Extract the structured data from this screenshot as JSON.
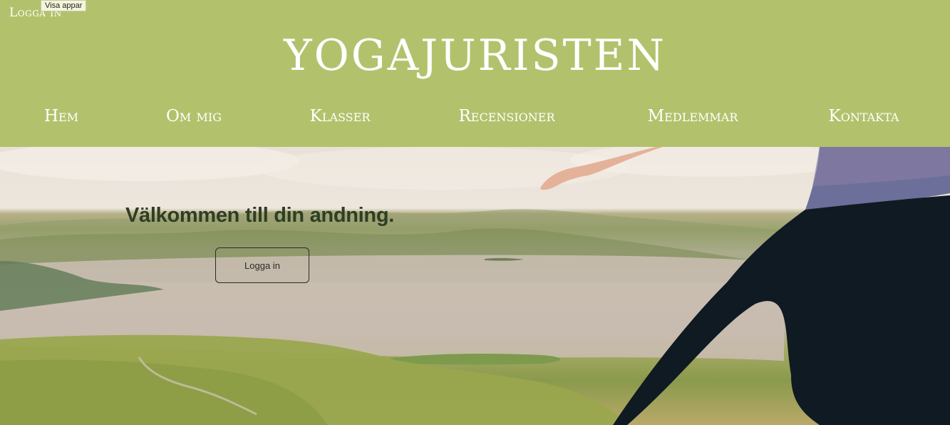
{
  "header": {
    "login_link": "Logga in",
    "tooltip": "Visa appar",
    "site_title": "YOGAJURISTEN",
    "background_color": "#b2c26c"
  },
  "nav": {
    "items": [
      {
        "label": "Hem"
      },
      {
        "label": "Om mig"
      },
      {
        "label": "Klasser"
      },
      {
        "label": "Recensioner"
      },
      {
        "label": "Medlemmar"
      },
      {
        "label": "Kontakta"
      }
    ]
  },
  "hero": {
    "heading": "Välkommen till din andning.",
    "button_label": "Logga in",
    "heading_color": "#2e3e24"
  }
}
